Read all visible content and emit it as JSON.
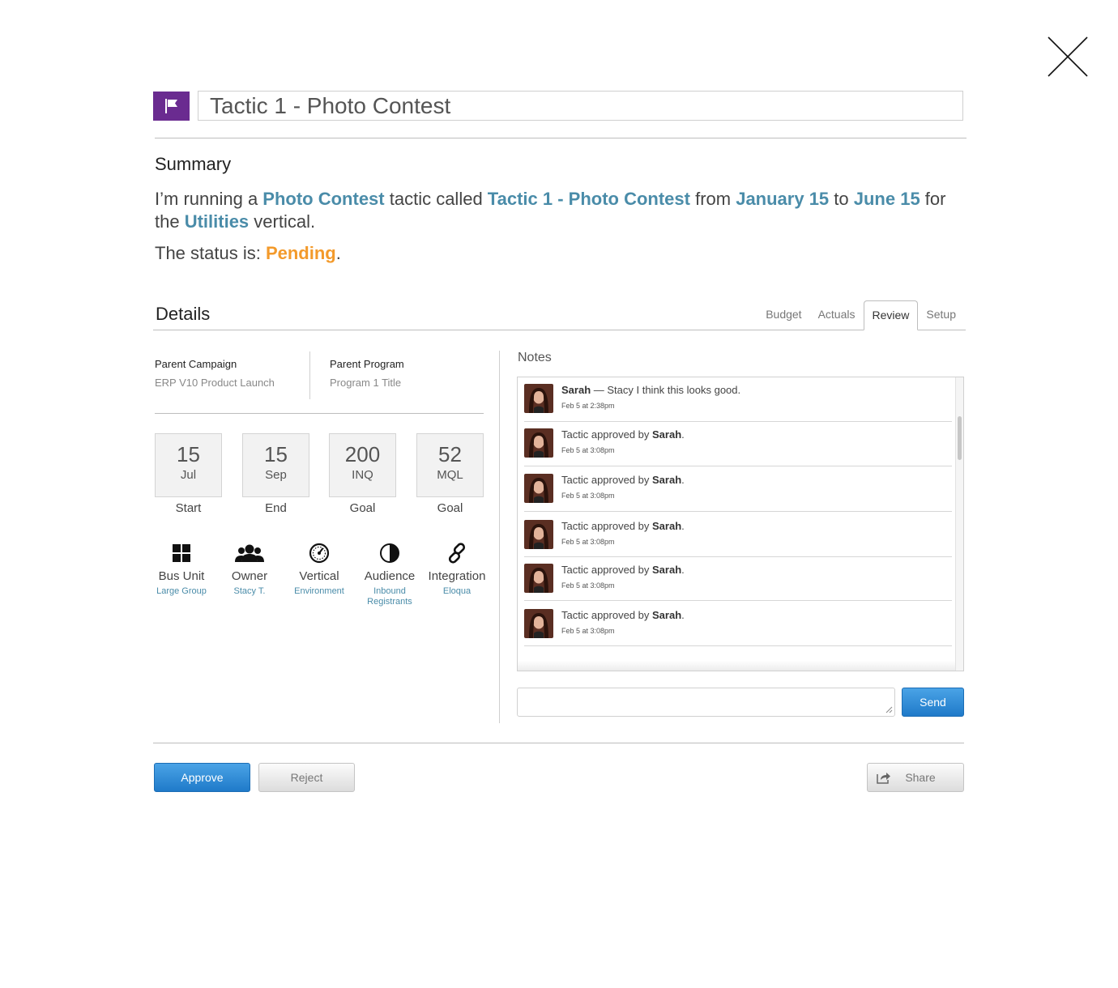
{
  "header": {
    "title_value": "Tactic 1 - Photo Contest"
  },
  "summary": {
    "heading": "Summary",
    "t1": "I’m running a ",
    "tactic_type": "Photo Contest",
    "t2": " tactic called ",
    "tactic_name": "Tactic 1 - Photo Contest",
    "t3": " from ",
    "start_date": "January 15",
    "t4": " to ",
    "end_date": "June 15",
    "t5": " for the ",
    "vertical": "Utilities",
    "t6": " vertical.",
    "status_prefix": "The status is: ",
    "status": "Pending",
    "status_suffix": "."
  },
  "details": {
    "heading": "Details",
    "tabs": [
      {
        "label": "Budget"
      },
      {
        "label": "Actuals"
      },
      {
        "label": "Review",
        "active": true
      },
      {
        "label": "Setup"
      }
    ],
    "parent_campaign_label": "Parent Campaign",
    "parent_campaign_value": "ERP V10 Product Launch",
    "parent_program_label": "Parent Program",
    "parent_program_value": "Program 1 Title",
    "stats": [
      {
        "value": "15",
        "unit": "Jul",
        "label": "Start"
      },
      {
        "value": "15",
        "unit": "Sep",
        "label": "End"
      },
      {
        "value": "200",
        "unit": "INQ",
        "label": "Goal"
      },
      {
        "value": "52",
        "unit": "MQL",
        "label": "Goal"
      }
    ],
    "attributes": [
      {
        "icon": "grid-icon",
        "label": "Bus Unit",
        "value": "Large Group"
      },
      {
        "icon": "people-icon",
        "label": "Owner",
        "value": "Stacy T."
      },
      {
        "icon": "speedometer-icon",
        "label": "Vertical",
        "value": "Environment"
      },
      {
        "icon": "contrast-icon",
        "label": "Audience",
        "value": "Inbound Registrants"
      },
      {
        "icon": "link-icon",
        "label": "Integration",
        "value": "Eloqua"
      }
    ]
  },
  "notes": {
    "heading": "Notes",
    "items": [
      {
        "author": "Sarah",
        "text": " — Stacy I think this looks good.",
        "time": "Feb 5 at 2:38pm"
      },
      {
        "prefix": "Tactic approved by ",
        "author": "Sarah",
        "suffix": ".",
        "time": "Feb 5 at 3:08pm"
      },
      {
        "prefix": "Tactic approved by ",
        "author": "Sarah",
        "suffix": ".",
        "time": "Feb 5 at 3:08pm"
      },
      {
        "prefix": "Tactic approved by ",
        "author": "Sarah",
        "suffix": ".",
        "time": "Feb 5 at 3:08pm"
      },
      {
        "prefix": "Tactic approved by ",
        "author": "Sarah",
        "suffix": ".",
        "time": "Feb 5 at 3:08pm"
      },
      {
        "prefix": "Tactic approved by ",
        "author": "Sarah",
        "suffix": ".",
        "time": "Feb 5 at 3:08pm"
      }
    ],
    "input_value": "",
    "send_label": "Send"
  },
  "actions": {
    "approve_label": "Approve",
    "reject_label": "Reject",
    "share_label": "Share"
  },
  "colors": {
    "brand_purple": "#6a2b90",
    "link_blue": "#4a8ca9",
    "status_orange": "#f39a2b",
    "button_blue": "#1f7ac9"
  }
}
